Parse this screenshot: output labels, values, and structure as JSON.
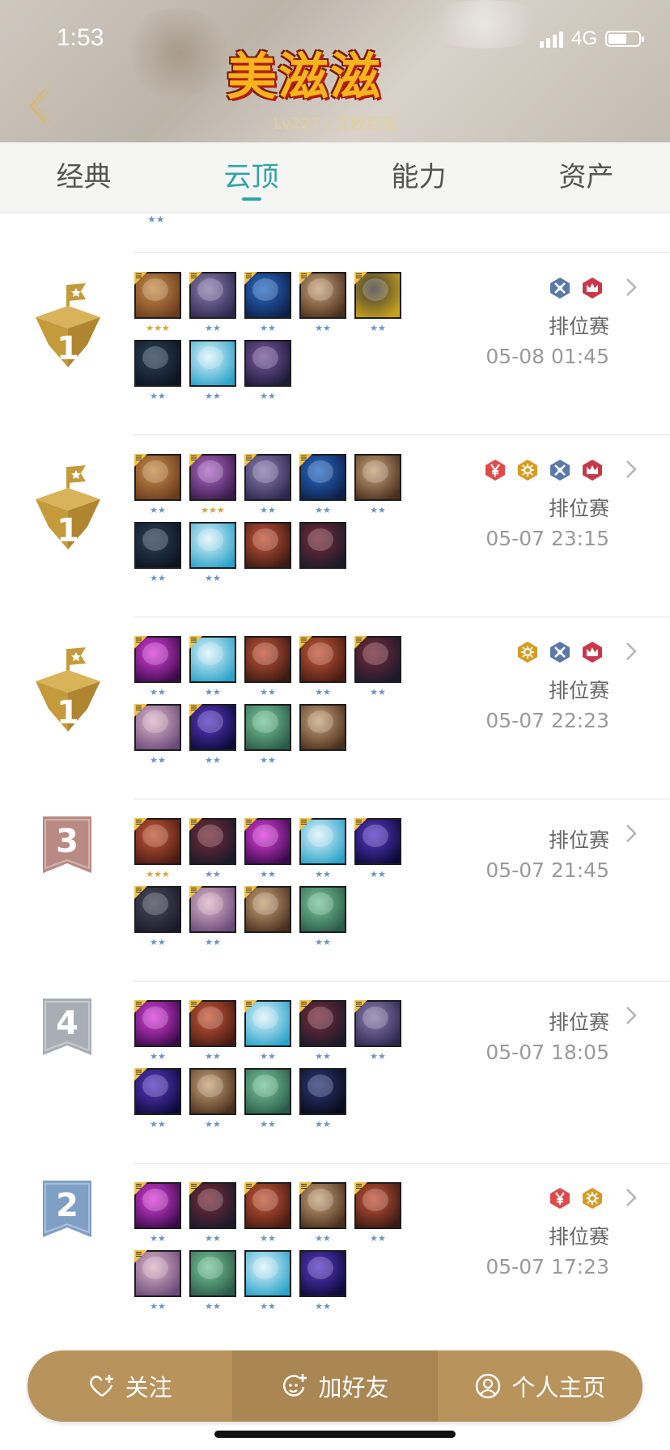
{
  "status_bar": {
    "time": "1:53",
    "network": "4G"
  },
  "profile": {
    "nickname": "美滋滋",
    "level_line": "Lv227 | 艾欧尼亚"
  },
  "tabs": [
    {
      "label": "经典",
      "active": false
    },
    {
      "label": "云顶",
      "active": true
    },
    {
      "label": "能力",
      "active": false
    },
    {
      "label": "资产",
      "active": false
    }
  ],
  "matches": [
    {
      "placement": "1",
      "mode": "排位赛",
      "time": "05-08 01:45",
      "augments": [
        "sword-shield-icon",
        "crown-icon"
      ],
      "units": [
        {
          "palette": [
            "#c98f4a",
            "#6b3b1c"
          ],
          "stars": 3,
          "tag": true
        },
        {
          "palette": [
            "#8a7fb0",
            "#2e2850"
          ],
          "stars": 2,
          "tag": true
        },
        {
          "palette": [
            "#2a6dc9",
            "#0d1f4a"
          ],
          "stars": 2,
          "tag": true
        },
        {
          "palette": [
            "#c9a57a",
            "#4a2f1c"
          ],
          "stars": 2,
          "tag": true
        },
        {
          "palette": [
            "#3a3a3a",
            "#c9a21c"
          ],
          "stars": 2,
          "tag": true
        },
        {
          "palette": [
            "#2d4158",
            "#0b1420"
          ],
          "stars": 2,
          "tag": false
        },
        {
          "palette": [
            "#dff4fb",
            "#2aa3c9"
          ],
          "stars": 2,
          "tag": false
        },
        {
          "palette": [
            "#7a5aa0",
            "#1c1a3a"
          ],
          "stars": 2,
          "tag": false
        }
      ]
    },
    {
      "placement": "1",
      "mode": "排位赛",
      "time": "05-07 23:15",
      "augments": [
        "yen-icon",
        "gear-icon",
        "sword-shield-icon",
        "crown-icon"
      ],
      "units": [
        {
          "palette": [
            "#c98f4a",
            "#6b3b1c"
          ],
          "stars": 2,
          "tag": true
        },
        {
          "palette": [
            "#b06ac9",
            "#3a1a4a"
          ],
          "stars": 3,
          "tag": true
        },
        {
          "palette": [
            "#8a7fb0",
            "#2e2850"
          ],
          "stars": 2,
          "tag": true
        },
        {
          "palette": [
            "#2a6dc9",
            "#0d1f4a"
          ],
          "stars": 2,
          "tag": true
        },
        {
          "palette": [
            "#c9a57a",
            "#4a2f1c"
          ],
          "stars": 2,
          "tag": false
        },
        {
          "palette": [
            "#2d4158",
            "#0b1420"
          ],
          "stars": 2,
          "tag": false
        },
        {
          "palette": [
            "#dff4fb",
            "#2aa3c9"
          ],
          "stars": 2,
          "tag": false
        },
        {
          "palette": [
            "#c9553a",
            "#3a1a12"
          ],
          "stars": 0,
          "tag": false
        },
        {
          "palette": [
            "#7a2a3a",
            "#1a1a2a"
          ],
          "stars": 0,
          "tag": false
        }
      ]
    },
    {
      "placement": "1",
      "mode": "排位赛",
      "time": "05-07 22:23",
      "augments": [
        "gear-icon",
        "sword-shield-icon",
        "crown-icon"
      ],
      "units": [
        {
          "palette": [
            "#e040e0",
            "#3a0a4a"
          ],
          "stars": 2,
          "tag": true
        },
        {
          "palette": [
            "#dff4fb",
            "#2aa3c9"
          ],
          "stars": 2,
          "tag": true
        },
        {
          "palette": [
            "#c9553a",
            "#3a1a12"
          ],
          "stars": 2,
          "tag": false
        },
        {
          "palette": [
            "#c95a3a",
            "#4a1a12"
          ],
          "stars": 2,
          "tag": true
        },
        {
          "palette": [
            "#7a2a3a",
            "#1a1a2a"
          ],
          "stars": 2,
          "tag": true
        },
        {
          "palette": [
            "#e0b8c9",
            "#6a4a7a"
          ],
          "stars": 2,
          "tag": true
        },
        {
          "palette": [
            "#5a3ac9",
            "#0d0a3a"
          ],
          "stars": 2,
          "tag": true
        },
        {
          "palette": [
            "#7ac99a",
            "#2a5a4a"
          ],
          "stars": 2,
          "tag": false
        },
        {
          "palette": [
            "#c9a57a",
            "#4a2f1c"
          ],
          "stars": 0,
          "tag": false
        }
      ]
    },
    {
      "placement": "3",
      "mode": "排位赛",
      "time": "05-07 21:45",
      "augments": [],
      "units": [
        {
          "palette": [
            "#c95a3a",
            "#4a1a12"
          ],
          "stars": 3,
          "tag": true
        },
        {
          "palette": [
            "#7a2a3a",
            "#1a1a2a"
          ],
          "stars": 2,
          "tag": true
        },
        {
          "palette": [
            "#e040e0",
            "#3a0a4a"
          ],
          "stars": 2,
          "tag": true
        },
        {
          "palette": [
            "#dff4fb",
            "#2aa3c9"
          ],
          "stars": 2,
          "tag": true
        },
        {
          "palette": [
            "#5a3ac9",
            "#0d0a3a"
          ],
          "stars": 2,
          "tag": true
        },
        {
          "palette": [
            "#4a4a5a",
            "#1a1a2a"
          ],
          "stars": 2,
          "tag": true
        },
        {
          "palette": [
            "#e0b8c9",
            "#6a4a7a"
          ],
          "stars": 2,
          "tag": true
        },
        {
          "palette": [
            "#c9a57a",
            "#4a2f1c"
          ],
          "stars": 0,
          "tag": true
        },
        {
          "palette": [
            "#7ac99a",
            "#2a5a4a"
          ],
          "stars": 2,
          "tag": false
        }
      ]
    },
    {
      "placement": "4",
      "mode": "排位赛",
      "time": "05-07 18:05",
      "augments": [],
      "units": [
        {
          "palette": [
            "#e040e0",
            "#3a0a4a"
          ],
          "stars": 2,
          "tag": true
        },
        {
          "palette": [
            "#c95a3a",
            "#4a1a12"
          ],
          "stars": 2,
          "tag": true
        },
        {
          "palette": [
            "#dff4fb",
            "#2aa3c9"
          ],
          "stars": 2,
          "tag": true
        },
        {
          "palette": [
            "#7a2a3a",
            "#1a1a2a"
          ],
          "stars": 2,
          "tag": true
        },
        {
          "palette": [
            "#8a7fb0",
            "#2e2850"
          ],
          "stars": 2,
          "tag": true
        },
        {
          "palette": [
            "#5a3ac9",
            "#0d0a3a"
          ],
          "stars": 2,
          "tag": true
        },
        {
          "palette": [
            "#c9a57a",
            "#4a2f1c"
          ],
          "stars": 2,
          "tag": false
        },
        {
          "palette": [
            "#7ac99a",
            "#2a5a4a"
          ],
          "stars": 2,
          "tag": false
        },
        {
          "palette": [
            "#2a3a7a",
            "#0a0a1a"
          ],
          "stars": 2,
          "tag": false
        }
      ]
    },
    {
      "placement": "2",
      "mode": "排位赛",
      "time": "05-07 17:23",
      "augments": [
        "yen-icon",
        "gear-icon"
      ],
      "units": [
        {
          "palette": [
            "#e040e0",
            "#3a0a4a"
          ],
          "stars": 2,
          "tag": true
        },
        {
          "palette": [
            "#7a2a3a",
            "#1a1a2a"
          ],
          "stars": 2,
          "tag": true
        },
        {
          "palette": [
            "#c95a3a",
            "#4a1a12"
          ],
          "stars": 2,
          "tag": true
        },
        {
          "palette": [
            "#c9a57a",
            "#4a2f1c"
          ],
          "stars": 2,
          "tag": true
        },
        {
          "palette": [
            "#c9553a",
            "#3a1a12"
          ],
          "stars": 2,
          "tag": true
        },
        {
          "palette": [
            "#e0b8c9",
            "#6a4a7a"
          ],
          "stars": 2,
          "tag": true
        },
        {
          "palette": [
            "#7ac99a",
            "#2a5a4a"
          ],
          "stars": 2,
          "tag": false
        },
        {
          "palette": [
            "#dff4fb",
            "#2aa3c9"
          ],
          "stars": 2,
          "tag": false
        },
        {
          "palette": [
            "#5a3ac9",
            "#0d0a3a"
          ],
          "stars": 2,
          "tag": false
        }
      ]
    }
  ],
  "bottom_bar": {
    "follow": "关注",
    "add_friend": "加好友",
    "homepage": "个人主页"
  },
  "colors": {
    "accent": "#2fa4a6",
    "gold_badge": "#c49a3a",
    "bar": "#b8935c"
  }
}
